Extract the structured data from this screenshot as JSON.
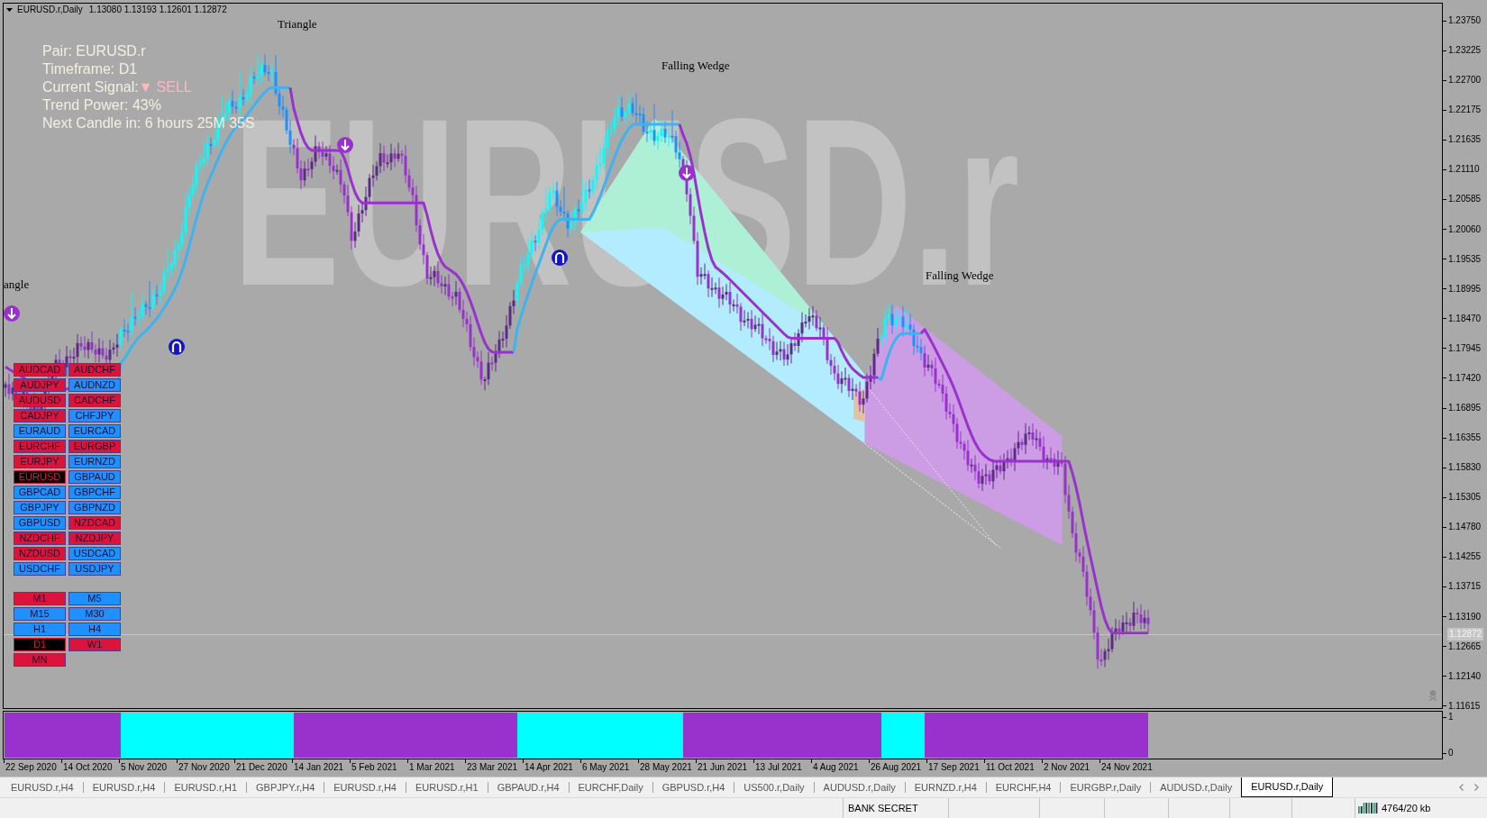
{
  "chart": {
    "symbol": "EURUSD.r,Daily",
    "ohlc": "1.13080 1.13193 1.12601 1.12872",
    "watermark": "EURUSD.r",
    "info": {
      "pair": "Pair: EURUSD.r",
      "timeframe": "Timeframe: D1",
      "signal_label": "Current Signal:",
      "signal_arrow": "▼",
      "signal_value": "SELL",
      "trend_power": "Trend Power: 43%",
      "next_candle": "Next Candle in: 6 hours 25M 35S"
    },
    "pattern_labels": [
      "Triangle",
      "Falling Wedge",
      "Falling Wedge",
      "angle"
    ],
    "signal_markers": [
      {
        "kind": "down"
      },
      {
        "kind": "down"
      },
      {
        "kind": "up"
      },
      {
        "kind": "down"
      },
      {
        "kind": "up"
      }
    ],
    "pairs": [
      {
        "label": "AUDCAD",
        "color": "#dc143c",
        "selected": false
      },
      {
        "label": "AUDCHF",
        "color": "#dc143c",
        "selected": false
      },
      {
        "label": "AUDJPY",
        "color": "#dc143c",
        "selected": false
      },
      {
        "label": "AUDNZD",
        "color": "#1e90ff",
        "selected": false
      },
      {
        "label": "AUDUSD",
        "color": "#dc143c",
        "selected": false
      },
      {
        "label": "CADCHF",
        "color": "#dc143c",
        "selected": false
      },
      {
        "label": "CADJPY",
        "color": "#dc143c",
        "selected": false
      },
      {
        "label": "CHFJPY",
        "color": "#1e90ff",
        "selected": false
      },
      {
        "label": "EURAUD",
        "color": "#1e90ff",
        "selected": false
      },
      {
        "label": "EURCAD",
        "color": "#1e90ff",
        "selected": false
      },
      {
        "label": "EURCHF",
        "color": "#dc143c",
        "selected": false
      },
      {
        "label": "EURGBP",
        "color": "#dc143c",
        "selected": false
      },
      {
        "label": "EURJPY",
        "color": "#dc143c",
        "selected": false
      },
      {
        "label": "EURNZD",
        "color": "#1e90ff",
        "selected": false
      },
      {
        "label": "EURUSD",
        "color": "#dc143c",
        "selected": true
      },
      {
        "label": "GBPAUD",
        "color": "#1e90ff",
        "selected": false
      },
      {
        "label": "GBPCAD",
        "color": "#1e90ff",
        "selected": false
      },
      {
        "label": "GBPCHF",
        "color": "#1e90ff",
        "selected": false
      },
      {
        "label": "GBPJPY",
        "color": "#1e90ff",
        "selected": false
      },
      {
        "label": "GBPNZD",
        "color": "#1e90ff",
        "selected": false
      },
      {
        "label": "GBPUSD",
        "color": "#1e90ff",
        "selected": false
      },
      {
        "label": "NZDCAD",
        "color": "#dc143c",
        "selected": false
      },
      {
        "label": "NZDCHF",
        "color": "#dc143c",
        "selected": false
      },
      {
        "label": "NZDJPY",
        "color": "#dc143c",
        "selected": false
      },
      {
        "label": "NZDUSD",
        "color": "#dc143c",
        "selected": false
      },
      {
        "label": "USDCAD",
        "color": "#1e90ff",
        "selected": false
      },
      {
        "label": "USDCHF",
        "color": "#1e90ff",
        "selected": false
      },
      {
        "label": "USDJPY",
        "color": "#1e90ff",
        "selected": false
      }
    ],
    "timeframes": [
      {
        "label": "M1",
        "color": "#dc143c",
        "selected": false
      },
      {
        "label": "M5",
        "color": "#1e90ff",
        "selected": false
      },
      {
        "label": "M15",
        "color": "#1e90ff",
        "selected": false
      },
      {
        "label": "M30",
        "color": "#1e90ff",
        "selected": false
      },
      {
        "label": "H1",
        "color": "#1e90ff",
        "selected": false
      },
      {
        "label": "H4",
        "color": "#1e90ff",
        "selected": false
      },
      {
        "label": "D1",
        "color": "#dc143c",
        "selected": true
      },
      {
        "label": "W1",
        "color": "#dc143c",
        "selected": false
      },
      {
        "label": "MN",
        "color": "#dc143c",
        "selected": false
      }
    ]
  },
  "price_axis": {
    "labels": [
      "1.23750",
      "1.23225",
      "1.22700",
      "1.22175",
      "1.21635",
      "1.21110",
      "1.20585",
      "1.20060",
      "1.19535",
      "1.18995",
      "1.18470",
      "1.17945",
      "1.17420",
      "1.16895",
      "1.16355",
      "1.15830",
      "1.15305",
      "1.14780",
      "1.14255",
      "1.13715",
      "1.13190",
      "1.12665",
      "1.12140",
      "1.11615"
    ],
    "current_price": "1.12872"
  },
  "indicator_axis": [
    "1",
    "0"
  ],
  "date_axis": [
    "22 Sep 2020",
    "14 Oct 2020",
    "5 Nov 2020",
    "27 Nov 2020",
    "21 Dec 2020",
    "14 Jan 2021",
    "5 Feb 2021",
    "1 Mar 2021",
    "23 Mar 2021",
    "14 Apr 2021",
    "6 May 2021",
    "28 May 2021",
    "21 Jun 2021",
    "13 Jul 2021",
    "4 Aug 2021",
    "26 Aug 2021",
    "17 Sep 2021",
    "11 Oct 2021",
    "2 Nov 2021",
    "24 Nov 2021"
  ],
  "tabs": [
    {
      "label": "EURUSD.r,H4",
      "selected": false
    },
    {
      "label": "EURUSD.r,H4",
      "selected": false
    },
    {
      "label": "EURUSD.r,H1",
      "selected": false
    },
    {
      "label": "GBPJPY.r,H4",
      "selected": false
    },
    {
      "label": "EURUSD.r,H4",
      "selected": false
    },
    {
      "label": "EURUSD.r,H1",
      "selected": false
    },
    {
      "label": "GBPAUD.r,H4",
      "selected": false
    },
    {
      "label": "EURCHF,Daily",
      "selected": false
    },
    {
      "label": "GBPUSD.r,H4",
      "selected": false
    },
    {
      "label": "US500.r,Daily",
      "selected": false
    },
    {
      "label": "AUDUSD.r,Daily",
      "selected": false
    },
    {
      "label": "EURNZD.r,H4",
      "selected": false
    },
    {
      "label": "EURCHF,H4",
      "selected": false
    },
    {
      "label": "EURGBP.r,Daily",
      "selected": false
    },
    {
      "label": "AUDUSD.r,Daily",
      "selected": false
    },
    {
      "label": "EURUSD.r,Daily",
      "selected": true
    }
  ],
  "status_bar": {
    "profile": "BANK SECRET",
    "traffic": "4764/20 kb"
  }
}
